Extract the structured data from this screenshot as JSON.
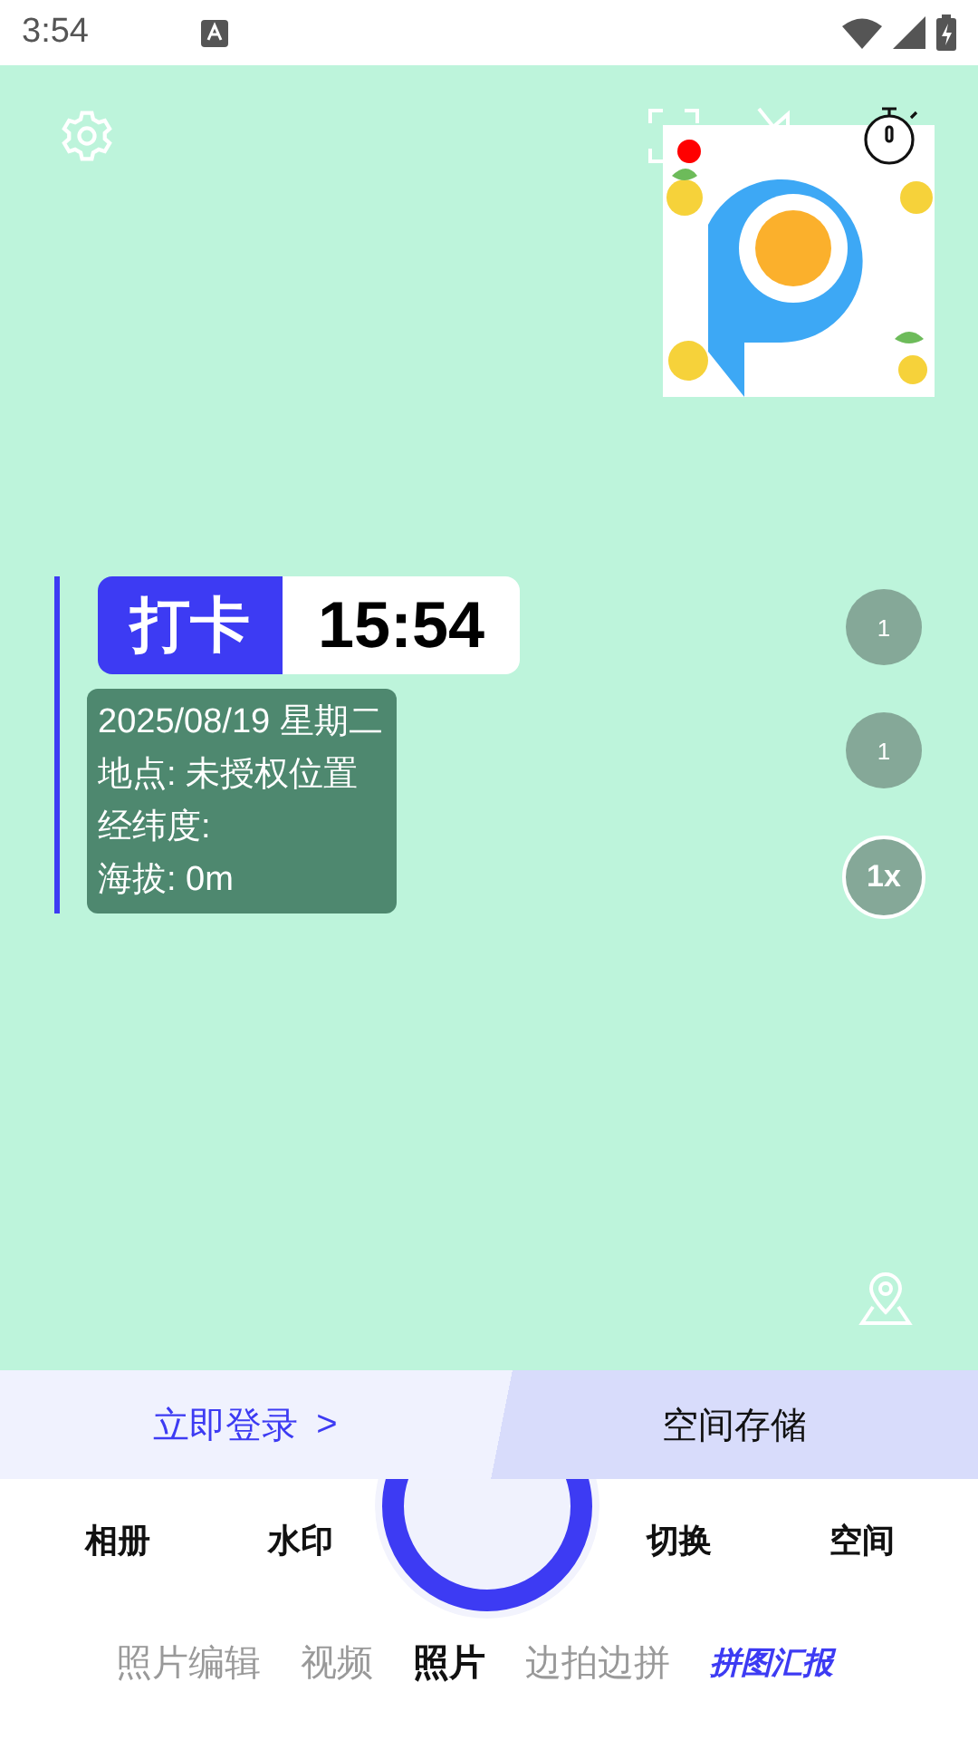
{
  "status_bar": {
    "time": "3:54"
  },
  "checkin": {
    "tag": "打卡",
    "time": "15:54",
    "lines": [
      "2025/08/19 星期二",
      "地点: 未授权位置",
      "经纬度:",
      "海拔: 0m"
    ]
  },
  "side_buttons": [
    {
      "label": "1",
      "outlined": false
    },
    {
      "label": "1",
      "outlined": false
    },
    {
      "label": "1x",
      "outlined": true
    }
  ],
  "top_bar": {
    "notification_badge": true
  },
  "banner": {
    "login": "立即登录",
    "login_arrow": ">",
    "storage": "空间存储"
  },
  "tools": [
    {
      "label": "相册"
    },
    {
      "label": "水印"
    },
    {
      "label": "切换"
    },
    {
      "label": "空间"
    }
  ],
  "modes": [
    {
      "label": "照片编辑",
      "selected": false,
      "kind": "plain"
    },
    {
      "label": "视频",
      "selected": false,
      "kind": "plain"
    },
    {
      "label": "照片",
      "selected": true,
      "kind": "plain"
    },
    {
      "label": "边拍边拼",
      "selected": false,
      "kind": "plain"
    },
    {
      "label": "拼图汇报",
      "selected": false,
      "kind": "promo"
    }
  ]
}
